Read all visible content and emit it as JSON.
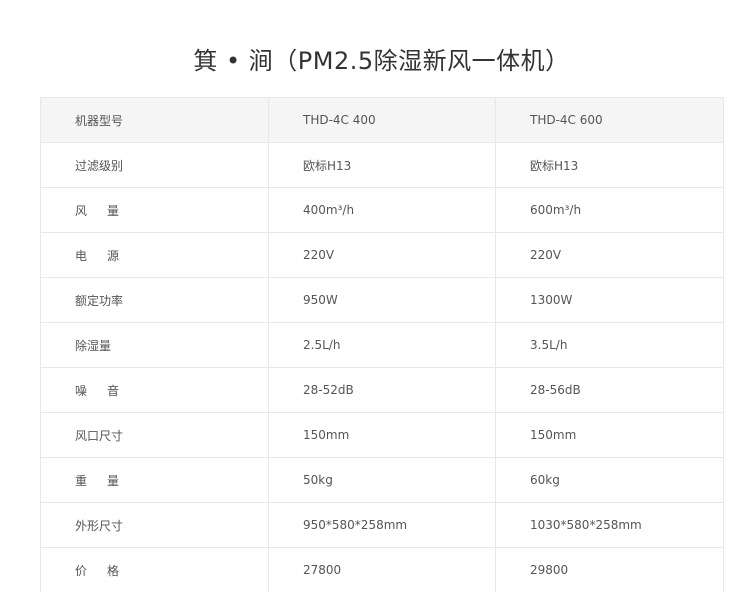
{
  "title": "箕 • 涧（PM2.5除湿新风一体机）",
  "table": {
    "header": {
      "label": "机器型号",
      "models": [
        "THD-4C 400",
        "THD-4C 600"
      ]
    },
    "rows": [
      {
        "label": "过滤级别",
        "values": [
          "欧标H13",
          "欧标H13"
        ],
        "spread": false
      },
      {
        "label": "风  量",
        "values": [
          "400m³/h",
          "600m³/h"
        ],
        "spread": true
      },
      {
        "label": "电  源",
        "values": [
          "220V",
          "220V"
        ],
        "spread": true
      },
      {
        "label": "额定功率",
        "values": [
          "950W",
          "1300W"
        ],
        "spread": false
      },
      {
        "label": "除湿量",
        "values": [
          "2.5L/h",
          "3.5L/h"
        ],
        "spread": false
      },
      {
        "label": "噪  音",
        "values": [
          "28-52dB",
          "28-56dB"
        ],
        "spread": true
      },
      {
        "label": "风口尺寸",
        "values": [
          "150mm",
          "150mm"
        ],
        "spread": false
      },
      {
        "label": "重  量",
        "values": [
          "50kg",
          "60kg"
        ],
        "spread": true
      },
      {
        "label": "外形尺寸",
        "values": [
          "950*580*258mm",
          "1030*580*258mm"
        ],
        "spread": false
      },
      {
        "label": "价  格",
        "values": [
          "27800",
          "29800"
        ],
        "spread": true
      }
    ]
  }
}
